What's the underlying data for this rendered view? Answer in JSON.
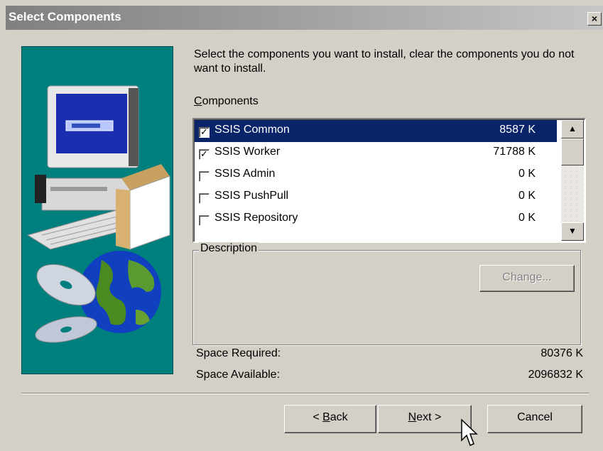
{
  "window": {
    "title": "Select Components",
    "close_label": "×"
  },
  "intro_text": "Select the components you want to install, clear the components you do not want to install.",
  "components_label_prefix": "C",
  "components_label_rest": "omponents",
  "components": [
    {
      "name": "SSIS Common",
      "size": "8587 K",
      "checked": true,
      "selected": true
    },
    {
      "name": "SSIS Worker",
      "size": "71788 K",
      "checked": true,
      "selected": false
    },
    {
      "name": "SSIS Admin",
      "size": "0 K",
      "checked": false,
      "selected": false
    },
    {
      "name": "SSIS PushPull",
      "size": "0 K",
      "checked": false,
      "selected": false
    },
    {
      "name": "SSIS Repository",
      "size": "0 K",
      "checked": false,
      "selected": false
    }
  ],
  "scrollbar": {
    "up_glyph": "▲",
    "down_glyph": "▼"
  },
  "description": {
    "legend": "Description",
    "change_label": "Change..."
  },
  "space": {
    "required_label": "Space Required:",
    "required_value": "80376 K",
    "available_label": "Space Available:",
    "available_value": "2096832 K"
  },
  "buttons": {
    "back_prefix": "< ",
    "back_key": "B",
    "back_rest": "ack",
    "next_key": "N",
    "next_rest": "ext >",
    "cancel": "Cancel"
  },
  "colors": {
    "selection": "#0a246a",
    "art_background": "#007f7f",
    "dialog": "#d4d0c8"
  }
}
